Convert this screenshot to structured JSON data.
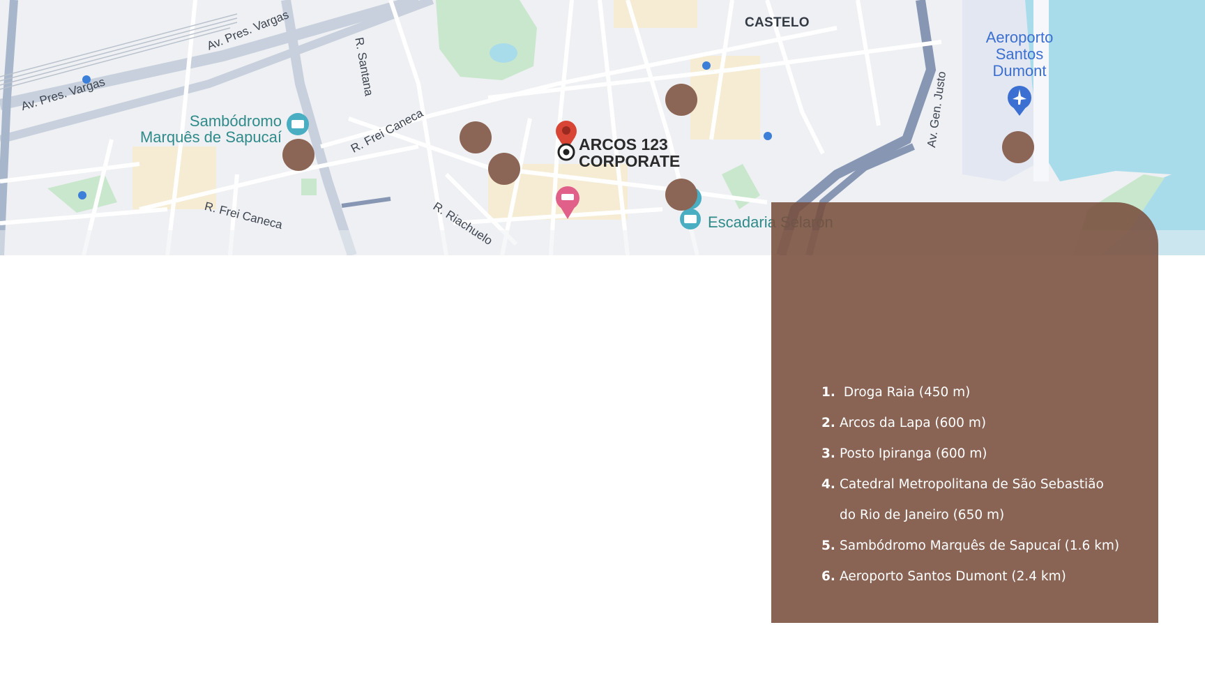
{
  "map": {
    "labels": {
      "castelo": "CASTELO",
      "av_pres_vargas_1": "Av. Pres. Vargas",
      "av_pres_vargas_2": "Av. Pres. Vargas",
      "r_santana": "R. Santana",
      "r_frei_caneca_1": "R. Frei Caneca",
      "r_frei_caneca_2": "R. Frei Caneca",
      "r_riachuelo": "R. Riachuelo",
      "av_gen_justo": "Av. Gen. Justo",
      "sambodromo_line1": "Sambódromo",
      "sambodromo_line2": "Marquês de Sapucaí",
      "escadaria": "Escadaria Selarón",
      "airport_line1": "Aeroporto",
      "airport_line2": "Santos",
      "airport_line3": "Dumont",
      "arcos_line1": "ARCOS 123",
      "arcos_line2": "CORPORATE"
    },
    "colors": {
      "water": "#a9dceb",
      "park": "#c8e6c9",
      "road": "#ffffff",
      "marker": "#8b6555",
      "pin": "#d84535"
    }
  },
  "panel": {
    "color": "#7a4e3e",
    "items": [
      {
        "num": "1.",
        "text": " Droga Raia (450 m)"
      },
      {
        "num": "2.",
        "text": "Arcos da Lapa (600 m)"
      },
      {
        "num": "3.",
        "text": "Posto Ipiranga (600 m)"
      },
      {
        "num": "4.",
        "text": "Catedral Metropolitana de São Sebastião do Rio de Janeiro (650 m)"
      },
      {
        "num": "5.",
        "text": "Sambódromo Marquês de Sapucaí (1.6 km)"
      },
      {
        "num": "6.",
        "text": "Aeroporto Santos Dumont (2.4 km)"
      }
    ]
  }
}
